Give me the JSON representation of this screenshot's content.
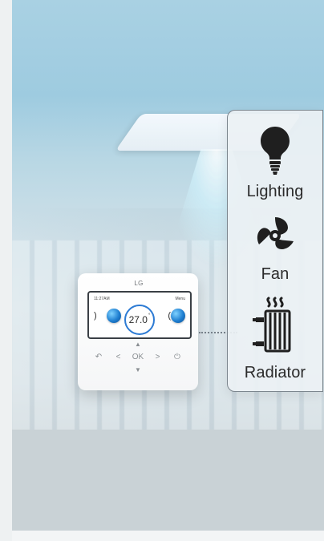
{
  "controller": {
    "brand": "LG",
    "temperature": "27.0",
    "temperature_unit": "°",
    "screen_header_left": "11:27AM",
    "screen_header_right": "Menu"
  },
  "panel": {
    "items": [
      {
        "label": "Lighting",
        "icon": "lightbulb-icon"
      },
      {
        "label": "Fan",
        "icon": "fan-icon"
      },
      {
        "label": "Radiator",
        "icon": "radiator-icon"
      }
    ]
  },
  "colors": {
    "accent": "#2d7bd4",
    "panel_border": "#7b858d"
  }
}
